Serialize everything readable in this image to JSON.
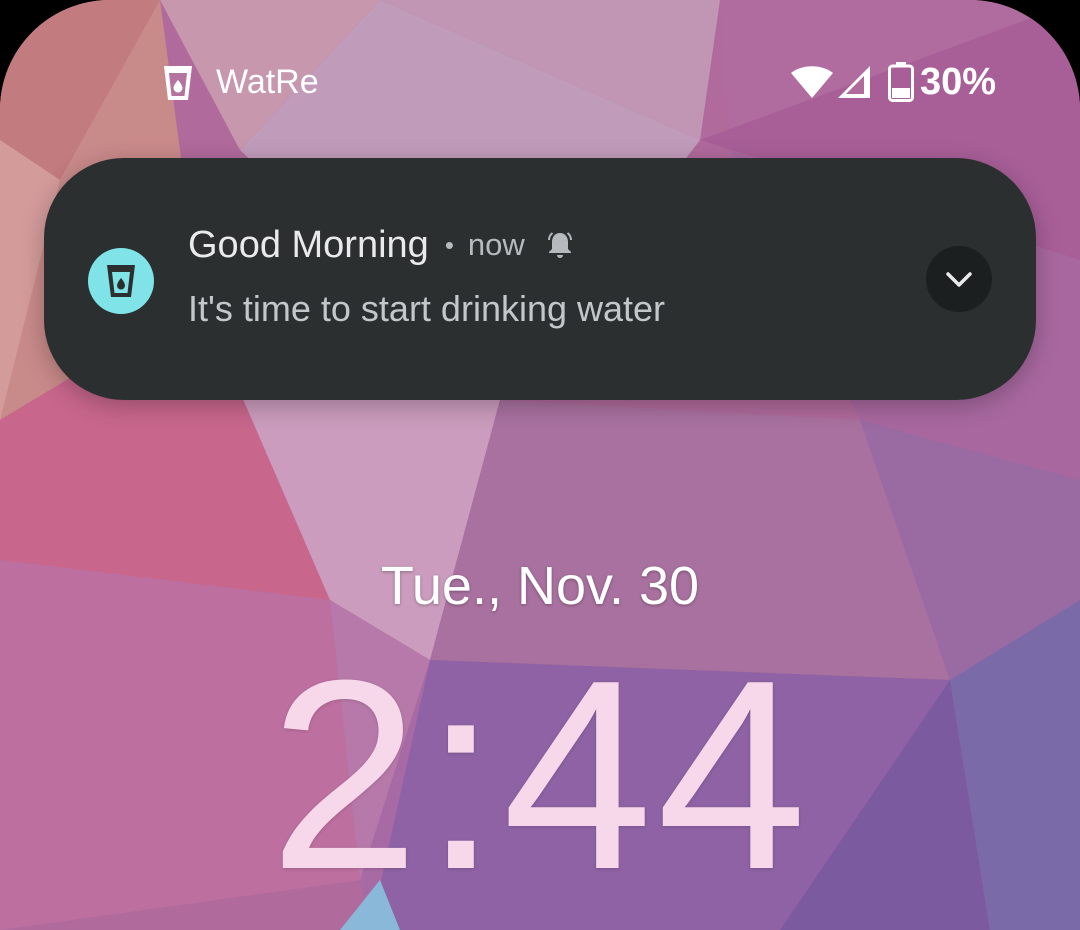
{
  "status_bar": {
    "app_icon": "water-glass-icon",
    "app_name": "WatRe",
    "wifi_icon": "wifi-icon",
    "signal_icon": "cell-signal-icon",
    "battery_icon": "battery-icon",
    "battery_percent": "30%"
  },
  "notification": {
    "app_icon": "water-glass-icon",
    "app_icon_color": "#7fe3e8",
    "title": "Good Morning",
    "separator": "•",
    "time": "now",
    "alert_icon": "bell-icon",
    "body": "It's time to start drinking water",
    "expand_icon": "chevron-down-icon",
    "background": "#2b2f30"
  },
  "lockscreen": {
    "date": "Tue., Nov. 30",
    "time": "2:44",
    "clock_color": "#f7d8ea"
  }
}
